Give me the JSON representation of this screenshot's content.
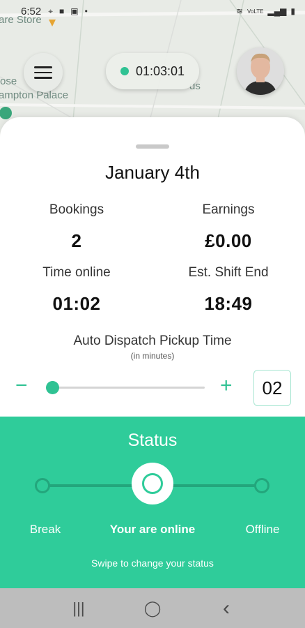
{
  "status_bar": {
    "time": "6:52",
    "icons_left": [
      "location-icon",
      "notification-icon",
      "gallery-icon",
      "dot-icon"
    ],
    "icons_right": [
      "wifi-icon",
      "volte-icon",
      "signal-icon",
      "battery-icon"
    ]
  },
  "map": {
    "labels": [
      "are Store",
      "ose",
      "ampton Palace",
      "ds"
    ]
  },
  "header": {
    "menu_icon": "hamburger-icon",
    "timer": "01:03:01",
    "timer_status_color": "#2fc293"
  },
  "sheet": {
    "date": "January 4th",
    "stats": {
      "bookings_label": "Bookings",
      "bookings_value": "2",
      "earnings_label": "Earnings",
      "earnings_value": "£0.00",
      "time_online_label": "Time online",
      "time_online_value": "01:02",
      "shift_end_label": "Est. Shift End",
      "shift_end_value": "18:49"
    },
    "dispatch": {
      "title": "Auto Dispatch Pickup Time",
      "subtitle": "(in minutes)",
      "minus": "−",
      "plus": "+",
      "value": "02",
      "slider_fraction": 0.0
    }
  },
  "status": {
    "title": "Status",
    "options": [
      "Break",
      "Your are online",
      "Offline"
    ],
    "selected": "Your are online",
    "hint": "Swipe to change your status",
    "accent": "#2fcc9a"
  },
  "nav_bar": {
    "recent": "|||",
    "home": "◯",
    "back": "‹"
  }
}
